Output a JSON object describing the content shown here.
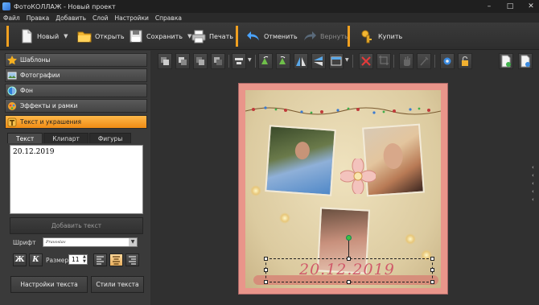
{
  "window": {
    "title": "ФотоКОЛЛАЖ - Новый проект",
    "controls": [
      "–",
      "□",
      "✕"
    ]
  },
  "menu": [
    "Файл",
    "Правка",
    "Добавить",
    "Слой",
    "Настройки",
    "Справка"
  ],
  "toolbar": {
    "new_label": "Новый",
    "open_label": "Открыть",
    "save_label": "Сохранить",
    "print_label": "Печать",
    "undo_label": "Отменить",
    "redo_label": "Вернуть",
    "buy_label": "Купить"
  },
  "sidebar": {
    "items": [
      {
        "label": "Шаблоны",
        "icon": "star-icon"
      },
      {
        "label": "Фотографии",
        "icon": "photos-icon"
      },
      {
        "label": "Фон",
        "icon": "background-icon"
      },
      {
        "label": "Эффекты и рамки",
        "icon": "effects-icon"
      },
      {
        "label": "Текст и украшения",
        "icon": "text-decor-icon"
      }
    ],
    "active_index": 4
  },
  "text_panel": {
    "tabs": [
      "Текст",
      "Клипарт",
      "Фигуры"
    ],
    "active_tab": 0,
    "text_value": "20.12.2019",
    "add_text_label": "Добавить текст",
    "font_label": "Шрифт",
    "font_value": "Pravoslav",
    "bold_label": "Ж",
    "italic_label": "К",
    "size_label": "Размер",
    "size_value": "11",
    "settings_label": "Настройки текста",
    "styles_label": "Стили текста"
  },
  "canvas": {
    "decor_text": "20.12.2019"
  },
  "colors": {
    "accent": "#f0a020",
    "active_tab": "#f08c14",
    "canvas_bg": "#e9958a"
  }
}
